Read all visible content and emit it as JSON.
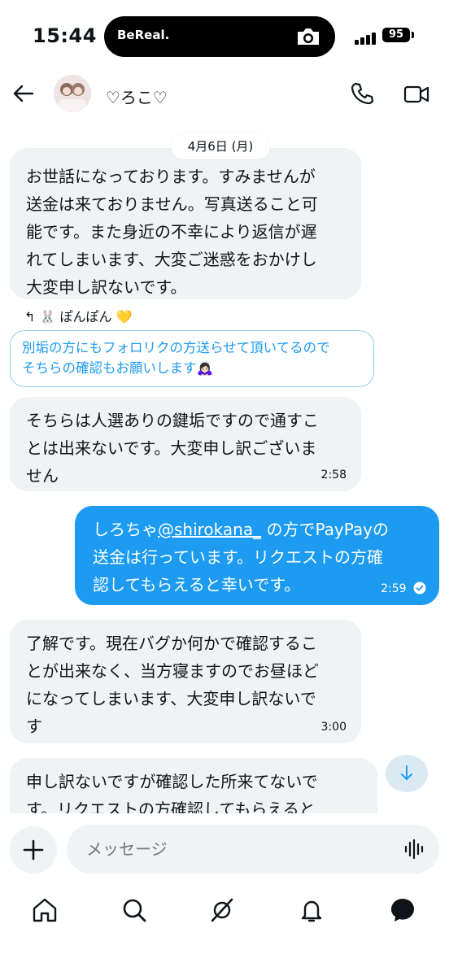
{
  "status": {
    "time": "15:44",
    "island_label": "BeReal.",
    "battery": "95"
  },
  "header": {
    "contact_name": "♡ろこ♡"
  },
  "date_chip": "4月6日 (月)",
  "messages": [
    {
      "lines": [
        "お世話になっております。すみませんが",
        "送金は来ておりません。写真送ること可",
        "能です。また身近の不幸により返信が遅",
        "れてしまいます、大変ご迷惑をおかけし",
        "大変申し訳ないです。"
      ]
    },
    {
      "lines": [
        "そちらは人選ありの鍵垢ですので通すこ",
        "とは出来ないです。大変申し訳ございま",
        "せん"
      ],
      "time": "2:58"
    },
    {
      "line1_a": "しろちゃ",
      "line1_mention": "@shirokana_",
      "line1_b": "の方でPayPayの",
      "lines": [
        "送金は行っています。リクエストの方確",
        "認してもらえると幸いです。"
      ],
      "time": "2:59"
    },
    {
      "lines": [
        "了解です。現在バグか何かで確認するこ",
        "とが出来なく、当方寝ますのでお昼ほど",
        "になってしまいます、大変申し訳ないで",
        "す"
      ],
      "time": "3:00"
    },
    {
      "lines": [
        "申し訳ないですが確認した所来てないで",
        "す。リクエストの方確認してもらえると"
      ]
    }
  ],
  "reaction": {
    "text": "🐰 ぽんぽん 💛"
  },
  "reply_preview": {
    "lines": [
      "別垢の方にもフォロリクの方送らせて頂いてるので",
      "そちらの確認もお願いします🙇🏻‍♀️"
    ]
  },
  "composer": {
    "placeholder": "メッセージ"
  },
  "nav": [
    "home-icon",
    "search-icon",
    "grok-icon",
    "notifications-icon",
    "messages-icon"
  ],
  "colors": {
    "accent": "#1d9bf0",
    "bubble_in": "#eff3f4",
    "text": "#0f1419"
  }
}
